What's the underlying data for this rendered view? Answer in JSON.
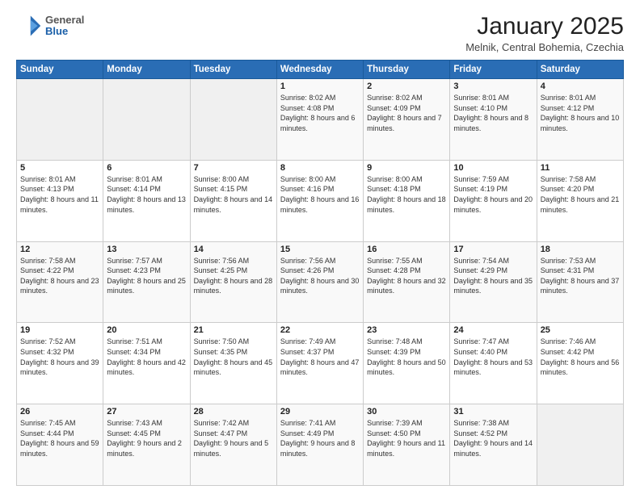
{
  "logo": {
    "general": "General",
    "blue": "Blue"
  },
  "header": {
    "title": "January 2025",
    "subtitle": "Melnik, Central Bohemia, Czechia"
  },
  "days_of_week": [
    "Sunday",
    "Monday",
    "Tuesday",
    "Wednesday",
    "Thursday",
    "Friday",
    "Saturday"
  ],
  "weeks": [
    [
      {
        "day": "",
        "info": ""
      },
      {
        "day": "",
        "info": ""
      },
      {
        "day": "",
        "info": ""
      },
      {
        "day": "1",
        "info": "Sunrise: 8:02 AM\nSunset: 4:08 PM\nDaylight: 8 hours and 6 minutes."
      },
      {
        "day": "2",
        "info": "Sunrise: 8:02 AM\nSunset: 4:09 PM\nDaylight: 8 hours and 7 minutes."
      },
      {
        "day": "3",
        "info": "Sunrise: 8:01 AM\nSunset: 4:10 PM\nDaylight: 8 hours and 8 minutes."
      },
      {
        "day": "4",
        "info": "Sunrise: 8:01 AM\nSunset: 4:12 PM\nDaylight: 8 hours and 10 minutes."
      }
    ],
    [
      {
        "day": "5",
        "info": "Sunrise: 8:01 AM\nSunset: 4:13 PM\nDaylight: 8 hours and 11 minutes."
      },
      {
        "day": "6",
        "info": "Sunrise: 8:01 AM\nSunset: 4:14 PM\nDaylight: 8 hours and 13 minutes."
      },
      {
        "day": "7",
        "info": "Sunrise: 8:00 AM\nSunset: 4:15 PM\nDaylight: 8 hours and 14 minutes."
      },
      {
        "day": "8",
        "info": "Sunrise: 8:00 AM\nSunset: 4:16 PM\nDaylight: 8 hours and 16 minutes."
      },
      {
        "day": "9",
        "info": "Sunrise: 8:00 AM\nSunset: 4:18 PM\nDaylight: 8 hours and 18 minutes."
      },
      {
        "day": "10",
        "info": "Sunrise: 7:59 AM\nSunset: 4:19 PM\nDaylight: 8 hours and 20 minutes."
      },
      {
        "day": "11",
        "info": "Sunrise: 7:58 AM\nSunset: 4:20 PM\nDaylight: 8 hours and 21 minutes."
      }
    ],
    [
      {
        "day": "12",
        "info": "Sunrise: 7:58 AM\nSunset: 4:22 PM\nDaylight: 8 hours and 23 minutes."
      },
      {
        "day": "13",
        "info": "Sunrise: 7:57 AM\nSunset: 4:23 PM\nDaylight: 8 hours and 25 minutes."
      },
      {
        "day": "14",
        "info": "Sunrise: 7:56 AM\nSunset: 4:25 PM\nDaylight: 8 hours and 28 minutes."
      },
      {
        "day": "15",
        "info": "Sunrise: 7:56 AM\nSunset: 4:26 PM\nDaylight: 8 hours and 30 minutes."
      },
      {
        "day": "16",
        "info": "Sunrise: 7:55 AM\nSunset: 4:28 PM\nDaylight: 8 hours and 32 minutes."
      },
      {
        "day": "17",
        "info": "Sunrise: 7:54 AM\nSunset: 4:29 PM\nDaylight: 8 hours and 35 minutes."
      },
      {
        "day": "18",
        "info": "Sunrise: 7:53 AM\nSunset: 4:31 PM\nDaylight: 8 hours and 37 minutes."
      }
    ],
    [
      {
        "day": "19",
        "info": "Sunrise: 7:52 AM\nSunset: 4:32 PM\nDaylight: 8 hours and 39 minutes."
      },
      {
        "day": "20",
        "info": "Sunrise: 7:51 AM\nSunset: 4:34 PM\nDaylight: 8 hours and 42 minutes."
      },
      {
        "day": "21",
        "info": "Sunrise: 7:50 AM\nSunset: 4:35 PM\nDaylight: 8 hours and 45 minutes."
      },
      {
        "day": "22",
        "info": "Sunrise: 7:49 AM\nSunset: 4:37 PM\nDaylight: 8 hours and 47 minutes."
      },
      {
        "day": "23",
        "info": "Sunrise: 7:48 AM\nSunset: 4:39 PM\nDaylight: 8 hours and 50 minutes."
      },
      {
        "day": "24",
        "info": "Sunrise: 7:47 AM\nSunset: 4:40 PM\nDaylight: 8 hours and 53 minutes."
      },
      {
        "day": "25",
        "info": "Sunrise: 7:46 AM\nSunset: 4:42 PM\nDaylight: 8 hours and 56 minutes."
      }
    ],
    [
      {
        "day": "26",
        "info": "Sunrise: 7:45 AM\nSunset: 4:44 PM\nDaylight: 8 hours and 59 minutes."
      },
      {
        "day": "27",
        "info": "Sunrise: 7:43 AM\nSunset: 4:45 PM\nDaylight: 9 hours and 2 minutes."
      },
      {
        "day": "28",
        "info": "Sunrise: 7:42 AM\nSunset: 4:47 PM\nDaylight: 9 hours and 5 minutes."
      },
      {
        "day": "29",
        "info": "Sunrise: 7:41 AM\nSunset: 4:49 PM\nDaylight: 9 hours and 8 minutes."
      },
      {
        "day": "30",
        "info": "Sunrise: 7:39 AM\nSunset: 4:50 PM\nDaylight: 9 hours and 11 minutes."
      },
      {
        "day": "31",
        "info": "Sunrise: 7:38 AM\nSunset: 4:52 PM\nDaylight: 9 hours and 14 minutes."
      },
      {
        "day": "",
        "info": ""
      }
    ]
  ]
}
